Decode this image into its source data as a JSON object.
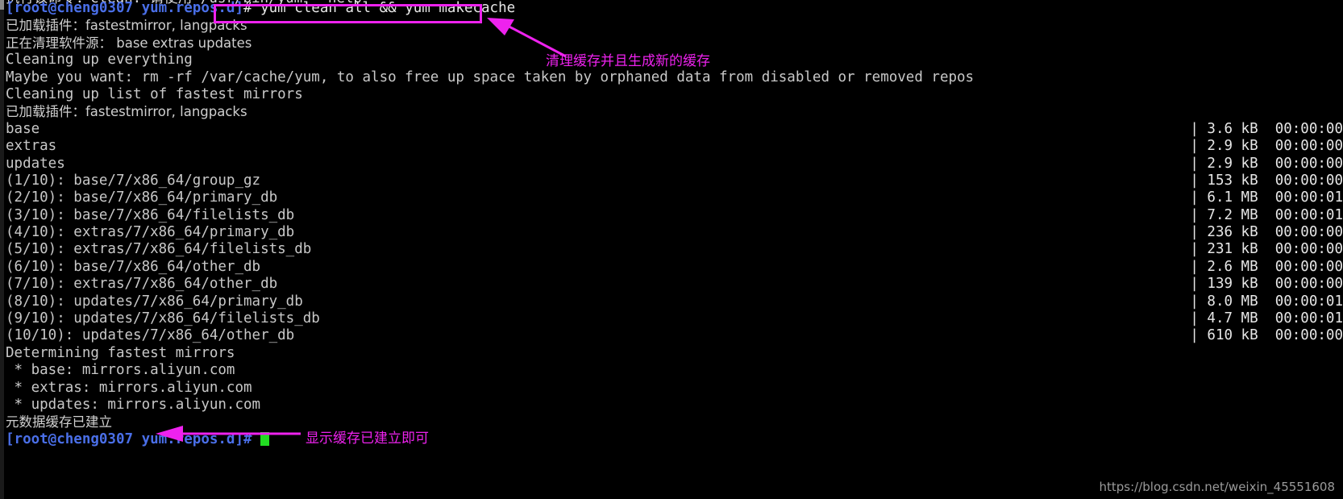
{
  "terminal": {
    "prompt_user_host": "[root@cheng0307 yum.repos.d]",
    "command": "# yum clean all && yum makecache",
    "cursor_glyph": "block-cursor",
    "clipped_top_line": "执行该命令：clean. 请使用 /usr/bin/yum --help",
    "lines": [
      {
        "kind": "prompt_cmd",
        "prompt": "[root@cheng0307 yum.repos.d]",
        "text": "# yum clean all && yum makecache"
      },
      {
        "kind": "cjk",
        "text": "已加载插件：fastestmirror, langpacks"
      },
      {
        "kind": "cjk",
        "text": "正在清理软件源： base extras updates"
      },
      {
        "kind": "plain",
        "text": "Cleaning up everything"
      },
      {
        "kind": "plain",
        "text": "Maybe you want: rm -rf /var/cache/yum, to also free up space taken by orphaned data from disabled or removed repos"
      },
      {
        "kind": "plain",
        "text": "Cleaning up list of fastest mirrors"
      },
      {
        "kind": "cjk",
        "text": "已加载插件：fastestmirror, langpacks"
      },
      {
        "kind": "repo",
        "text": "base",
        "meta": "| 3.6 kB  00:00:00"
      },
      {
        "kind": "repo",
        "text": "extras",
        "meta": "| 2.9 kB  00:00:00"
      },
      {
        "kind": "repo",
        "text": "updates",
        "meta": "| 2.9 kB  00:00:00"
      },
      {
        "kind": "repo",
        "text": "(1/10): base/7/x86_64/group_gz",
        "meta": "| 153 kB  00:00:00"
      },
      {
        "kind": "repo",
        "text": "(2/10): base/7/x86_64/primary_db",
        "meta": "| 6.1 MB  00:00:01"
      },
      {
        "kind": "repo",
        "text": "(3/10): base/7/x86_64/filelists_db",
        "meta": "| 7.2 MB  00:00:01"
      },
      {
        "kind": "repo",
        "text": "(4/10): extras/7/x86_64/primary_db",
        "meta": "| 236 kB  00:00:00"
      },
      {
        "kind": "repo",
        "text": "(5/10): extras/7/x86_64/filelists_db",
        "meta": "| 231 kB  00:00:00"
      },
      {
        "kind": "repo",
        "text": "(6/10): base/7/x86_64/other_db",
        "meta": "| 2.6 MB  00:00:00"
      },
      {
        "kind": "repo",
        "text": "(7/10): extras/7/x86_64/other_db",
        "meta": "| 139 kB  00:00:00"
      },
      {
        "kind": "repo",
        "text": "(8/10): updates/7/x86_64/primary_db",
        "meta": "| 8.0 MB  00:00:01"
      },
      {
        "kind": "repo",
        "text": "(9/10): updates/7/x86_64/filelists_db",
        "meta": "| 4.7 MB  00:00:01"
      },
      {
        "kind": "repo",
        "text": "(10/10): updates/7/x86_64/other_db",
        "meta": "| 610 kB  00:00:00"
      },
      {
        "kind": "plain",
        "text": "Determining fastest mirrors"
      },
      {
        "kind": "plain",
        "text": " * base: mirrors.aliyun.com"
      },
      {
        "kind": "plain",
        "text": " * extras: mirrors.aliyun.com"
      },
      {
        "kind": "plain",
        "text": " * updates: mirrors.aliyun.com"
      },
      {
        "kind": "cjk",
        "text": "元数据缓存已建立"
      },
      {
        "kind": "final_prompt",
        "prompt": "[root@cheng0307 yum.repos.d]#",
        "text": ""
      }
    ]
  },
  "annotations": [
    {
      "id": "cache-refresh-note",
      "text": "清理缓存并且生成新的缓存"
    },
    {
      "id": "cache-built-note",
      "text": "显示缓存已建立即可"
    }
  ],
  "watermark": {
    "text": "https://blog.csdn.net/weixin_45551608"
  },
  "colors": {
    "background": "#000000",
    "foreground": "#d8d8d8",
    "prompt_blue": "#4a6fe8",
    "annotation_magenta": "#ee22ee",
    "cursor_green": "#22dd22",
    "watermark_gray": "#9a9a9a"
  }
}
